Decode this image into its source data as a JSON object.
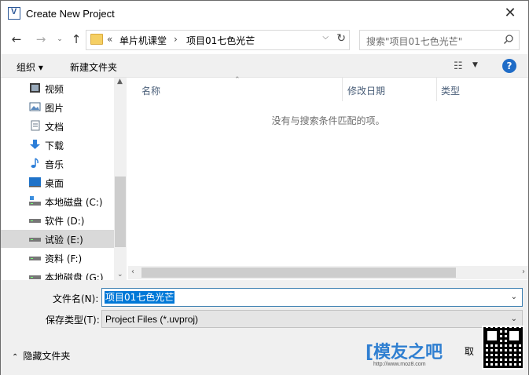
{
  "window": {
    "title": "Create New Project",
    "close_glyph": "✕"
  },
  "navigation": {
    "back_glyph": "←",
    "forward_glyph": "→",
    "recent_glyph": "⌄",
    "up_glyph": "↑"
  },
  "address": {
    "overflow": "«",
    "crumbs": [
      "单片机课堂",
      "项目01七色光芒"
    ],
    "separator": "›"
  },
  "search": {
    "placeholder": "搜索\"项目01七色光芒\""
  },
  "toolbar": {
    "organize": "组织 ▾",
    "new_folder": "新建文件夹",
    "view_glyph": "☷",
    "view_dd": "▼",
    "help": "?"
  },
  "sidebar": {
    "items": [
      {
        "label": "视频",
        "icon": "video-icon"
      },
      {
        "label": "图片",
        "icon": "pictures-icon"
      },
      {
        "label": "文档",
        "icon": "documents-icon"
      },
      {
        "label": "下载",
        "icon": "downloads-icon"
      },
      {
        "label": "音乐",
        "icon": "music-icon"
      },
      {
        "label": "桌面",
        "icon": "desktop-icon"
      },
      {
        "label": "本地磁盘 (C:)",
        "icon": "drive-c-icon"
      },
      {
        "label": "软件 (D:)",
        "icon": "drive-icon"
      },
      {
        "label": "试验 (E:)",
        "icon": "drive-icon",
        "selected": true
      },
      {
        "label": "资料 (F:)",
        "icon": "drive-icon"
      },
      {
        "label": "本地磁盘 (G:)",
        "icon": "drive-icon"
      }
    ]
  },
  "file_list": {
    "columns": [
      "名称",
      "修改日期",
      "类型"
    ],
    "empty_message": "没有与搜索条件匹配的项。"
  },
  "form": {
    "filename_label": "文件名(N):",
    "filename_value": "项目01七色光芒",
    "filetype_label": "保存类型(T):",
    "filetype_value": "Project Files (*.uvproj)",
    "hide_folders": "隐藏文件夹",
    "cancel_partial": "取"
  },
  "watermark": {
    "text": "[模友之吧",
    "url": "http://www.moz8.com"
  },
  "colors": {
    "selection": "#0078d7",
    "accent": "#1f6cc7",
    "nav_selected": "#d9d9d9"
  }
}
